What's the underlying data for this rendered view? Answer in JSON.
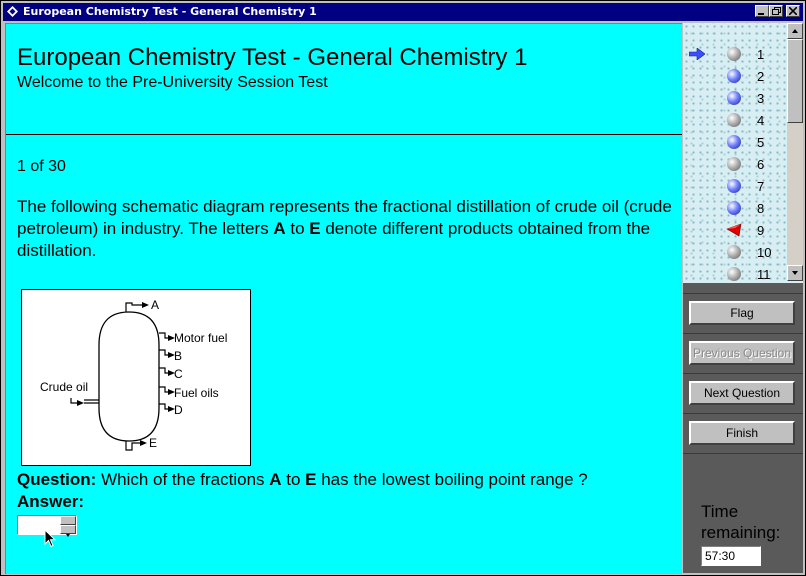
{
  "window": {
    "title": "European Chemistry Test - General Chemistry 1"
  },
  "header": {
    "title": "European Chemistry Test - General Chemistry 1",
    "subtitle": "Welcome to the Pre-University Session Test"
  },
  "question": {
    "counter": "1 of 30",
    "intro_1": "The following schematic diagram represents the fractional distillation of crude oil (crude petroleum) in industry. The letters ",
    "intro_a": "A",
    "intro_2": " to ",
    "intro_e": "E",
    "intro_3": " denote different products obtained from the distillation.",
    "q_label": "Question:",
    "q_1": " Which of the fractions ",
    "q_a": "A",
    "q_2": " to ",
    "q_e": "E",
    "q_3": " has the lowest boiling point range ?",
    "answer_label": "Answer:",
    "answer_value": ""
  },
  "diagram": {
    "labels": {
      "A": "A",
      "motor": "Motor fuel",
      "B": "B",
      "C": "C",
      "fuel": "Fuel oils",
      "D": "D",
      "E": "E",
      "crude": "Crude oil"
    }
  },
  "nav": {
    "items": [
      {
        "num": "1",
        "state": "gray",
        "current": true
      },
      {
        "num": "2",
        "state": "blue"
      },
      {
        "num": "3",
        "state": "blue"
      },
      {
        "num": "4",
        "state": "gray"
      },
      {
        "num": "5",
        "state": "blue"
      },
      {
        "num": "6",
        "state": "gray"
      },
      {
        "num": "7",
        "state": "blue"
      },
      {
        "num": "8",
        "state": "blue"
      },
      {
        "num": "9",
        "state": "flag"
      },
      {
        "num": "10",
        "state": "gray"
      },
      {
        "num": "11",
        "state": "gray"
      }
    ]
  },
  "buttons": {
    "flag": "Flag",
    "previous": "Previous Question",
    "next": "Next Question",
    "finish": "Finish"
  },
  "timer": {
    "label": "Time remaining:",
    "value": "57:30"
  },
  "colors": {
    "content_bg": "#00ffff",
    "title_bar": "#000080",
    "panel": "#5a5a5a"
  }
}
